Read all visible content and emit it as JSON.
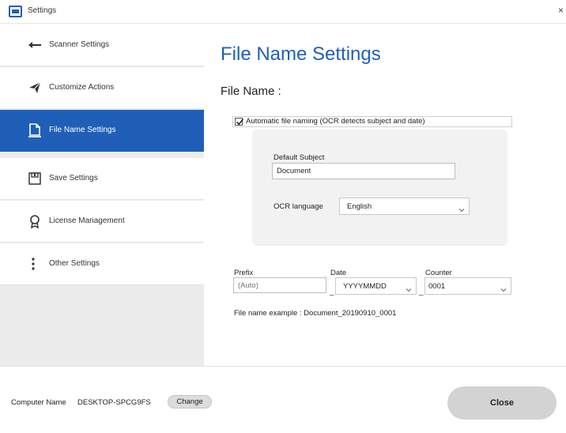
{
  "window": {
    "title": "Settings"
  },
  "sidebar": {
    "items": [
      {
        "label": "Scanner Settings",
        "icon": "arrow-left-icon",
        "active": false
      },
      {
        "label": "Customize Actions",
        "icon": "paper-plane-icon",
        "active": false
      },
      {
        "label": "File Name Settings",
        "icon": "document-icon",
        "active": true
      },
      {
        "label": "Save Settings",
        "icon": "save-icon",
        "active": false
      },
      {
        "label": "License Management",
        "icon": "award-ribbon-icon",
        "active": false
      },
      {
        "label": "Other Settings",
        "icon": "more-vertical-icon",
        "active": false
      }
    ]
  },
  "main": {
    "title": "File Name Settings",
    "section_label": "File Name :",
    "auto_naming": {
      "label": "Automatic file naming (OCR detects subject and date)",
      "checked": true
    },
    "default_subject": {
      "label": "Default Subject",
      "value": "Document"
    },
    "ocr_language": {
      "label": "OCR language",
      "value": "English"
    },
    "prefix": {
      "label": "Prefix",
      "placeholder": "(Auto)"
    },
    "date": {
      "label": "Date",
      "value": "YYYYMMDD"
    },
    "counter": {
      "label": "Counter",
      "value": "0001"
    },
    "separator": "_",
    "example": "File name example : Document_20190910_0001"
  },
  "footer": {
    "computer_name_label": "Computer Name",
    "computer_name_value": "DESKTOP-SPCG9FS",
    "change_label": "Change",
    "close_label": "Close"
  },
  "colors": {
    "accent": "#1f5fb8",
    "sidebar_bg": "#ececec",
    "panel_bg": "#f2f2f2"
  }
}
